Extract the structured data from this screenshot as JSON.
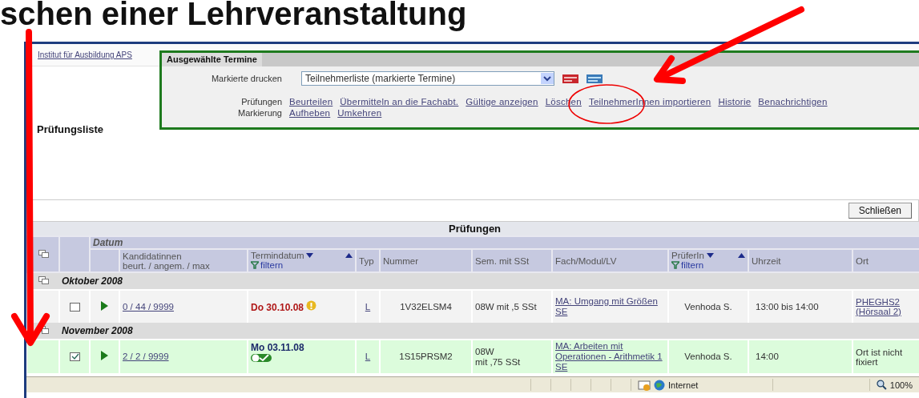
{
  "slide_title": "schen einer Lehrveranstaltung",
  "breadcrumb": "Institut für Ausbildung APS",
  "page_title": "Prüfungsliste",
  "selected_panel": {
    "title": "Ausgewählte Termine",
    "print_label": "Markierte drucken",
    "print_select": "Teilnehmerliste (markierte Termine)",
    "action_groups": [
      {
        "label": "Prüfungen",
        "links": [
          "Beurteilen",
          "Übermitteln an die Fachabt.",
          "Gültige anzeigen",
          "Löschen",
          "TeilnehmerInnen importieren",
          "Historie",
          "Benachrichtigen"
        ]
      },
      {
        "label": "Markierung",
        "links": [
          "Aufheben",
          "Umkehren"
        ]
      }
    ]
  },
  "close_button": "Schließen",
  "table": {
    "title": "Prüfungen",
    "group_header": "Datum",
    "columns": [
      {
        "label": "Kandidatinnen\nbeurt. / angem. / max",
        "sortable": false
      },
      {
        "label": "Termindatum",
        "sortable": true,
        "filter": "filtern"
      },
      {
        "label": "Typ",
        "sortable": false
      },
      {
        "label": "Nummer",
        "sortable": false
      },
      {
        "label": "Sem. mit SSt",
        "sortable": false
      },
      {
        "label": "Fach/Modul/LV",
        "sortable": false
      },
      {
        "label": "PrüferIn",
        "sortable": true,
        "filter": "filtern"
      },
      {
        "label": "Uhrzeit",
        "sortable": false
      },
      {
        "label": "Ort",
        "sortable": false
      }
    ],
    "groups": [
      {
        "label": "Oktober 2008",
        "rows": [
          {
            "kind": "warning",
            "checked": false,
            "selected": false,
            "count": "0 / 44 / 9999",
            "date": "Do 30.10.08",
            "typ": "L",
            "nummer": "1V32ELSM4",
            "sem": "08W mit ,5 SSt",
            "fach": "MA: Umgang mit Größen SE",
            "pruefer": "Venhoda S.",
            "uhrzeit": "13:00 bis 14:00",
            "ort": "PHEGHS2 (Hörsaal 2)",
            "ort_link": true
          }
        ]
      },
      {
        "label": "November 2008",
        "rows": [
          {
            "kind": "confirmed",
            "checked": true,
            "selected": true,
            "count": "2 / 2 / 9999",
            "date": "Mo 03.11.08",
            "typ": "L",
            "nummer": "1S15PRSM2",
            "sem": "08W\nmit ,75 SSt",
            "fach": "MA: Arbeiten mit Operationen - Arithmetik 1 SE",
            "pruefer": "Venhoda S.",
            "uhrzeit": "14:00",
            "ort": "Ort ist nicht fixiert",
            "ort_link": false
          }
        ]
      }
    ]
  },
  "status_bar": {
    "zone": "Internet",
    "zoom": "100%"
  }
}
